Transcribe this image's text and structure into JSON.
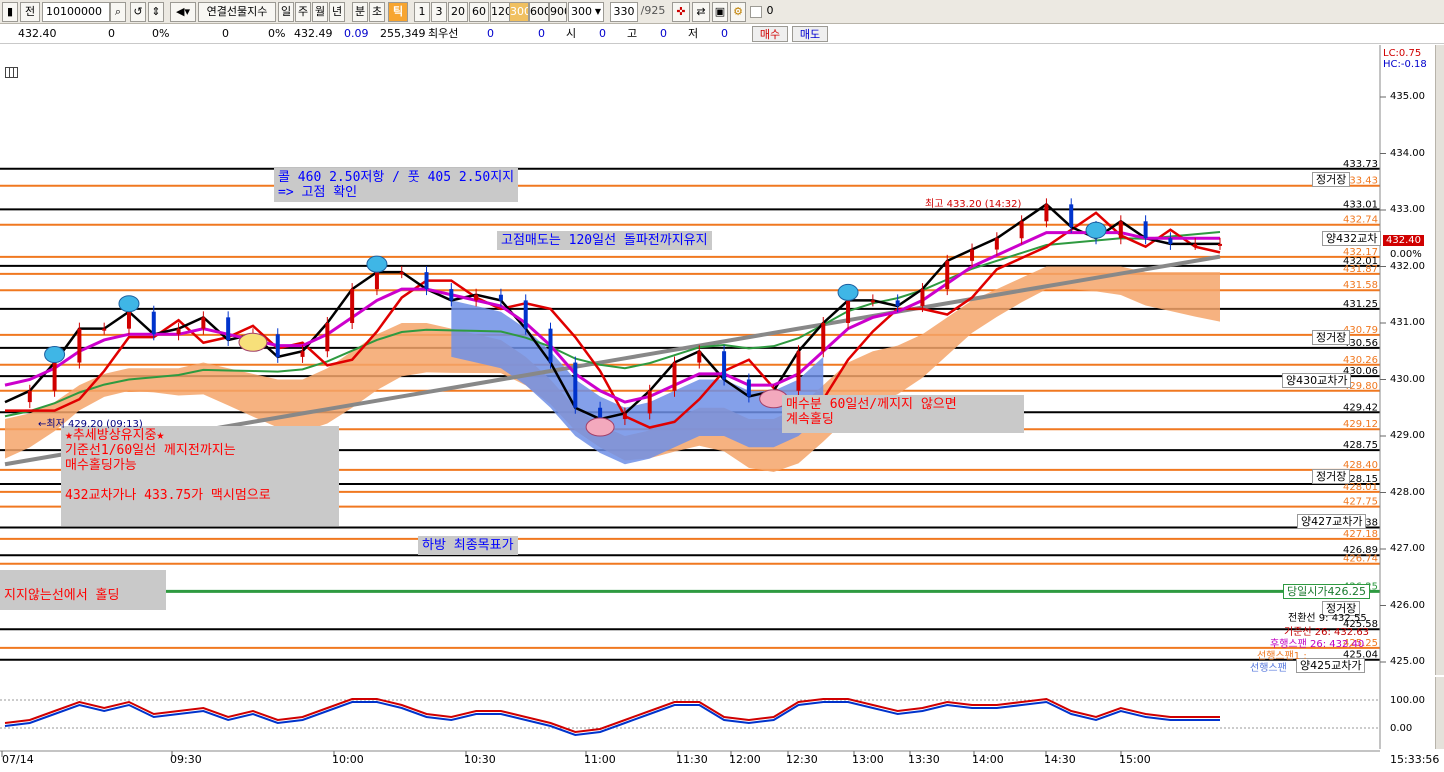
{
  "toolbar": {
    "code": "10100000",
    "labels_left": [
      "전"
    ],
    "product": "연결선물지수",
    "periods": [
      "일",
      "주",
      "월",
      "년",
      "분",
      "초",
      "틱"
    ],
    "intervals": [
      "1",
      "3",
      "20",
      "60",
      "120",
      "300",
      "600",
      "900"
    ],
    "count_value": "300",
    "page_value": "330",
    "page_total": "/925",
    "checkbox_label": "0"
  },
  "quotebar": {
    "price": "432.40",
    "v1": "0",
    "p1": "0%",
    "v2": "0",
    "p2": "0%",
    "last": "432.49",
    "change": "0.09",
    "volume": "255,349",
    "best_label": "최우선",
    "best_v1": "0",
    "best_v2": "0",
    "open_label": "시",
    "open_v": "0",
    "high_label": "고",
    "high_v": "0",
    "low_label": "저",
    "low_v": "0",
    "buy": "매수",
    "sell": "매도"
  },
  "right_info": {
    "lc": "LC:0.75",
    "hc": "HC:-0.18"
  },
  "chart_data": {
    "type": "line",
    "title": "",
    "y_ticks": [
      "435.00",
      "434.00",
      "433.00",
      "432.00",
      "431.00",
      "430.00",
      "429.00",
      "428.00",
      "427.00",
      "426.00",
      "425.00"
    ],
    "x_ticks": [
      "07/14",
      "09:30",
      "10:00",
      "10:30",
      "11:00",
      "11:30",
      "12:00",
      "12:30",
      "13:00",
      "13:30",
      "14:00",
      "14:30",
      "15:00"
    ],
    "current_time": "15:33:56",
    "current_price": "432.40",
    "lower_ticks": [
      "100.00",
      "0.00"
    ],
    "price_levels": [
      {
        "label": "433.73",
        "color": "#000000",
        "value": 433.73
      },
      {
        "label": "433.43",
        "color": "#f07820",
        "value": 433.43
      },
      {
        "label": "433.01",
        "color": "#000000",
        "value": 433.01
      },
      {
        "label": "432.74",
        "color": "#f07820",
        "value": 432.74
      },
      {
        "label": "432.17",
        "color": "#f07820",
        "value": 432.17
      },
      {
        "label": "432.01",
        "color": "#000000",
        "value": 432.01
      },
      {
        "label": "431.87",
        "color": "#f07820",
        "value": 431.87
      },
      {
        "label": "431.58",
        "color": "#f07820",
        "value": 431.58
      },
      {
        "label": "431.25",
        "color": "#000000",
        "value": 431.25
      },
      {
        "label": "430.79",
        "color": "#f07820",
        "value": 430.79
      },
      {
        "label": "430.56",
        "color": "#000000",
        "value": 430.56
      },
      {
        "label": "430.26",
        "color": "#f07820",
        "value": 430.26
      },
      {
        "label": "430.06",
        "color": "#000000",
        "value": 430.06
      },
      {
        "label": "429.80",
        "color": "#f07820",
        "value": 429.8
      },
      {
        "label": "429.42",
        "color": "#000000",
        "value": 429.42
      },
      {
        "label": "429.12",
        "color": "#f07820",
        "value": 429.12
      },
      {
        "label": "428.75",
        "color": "#000000",
        "value": 428.75
      },
      {
        "label": "428.40",
        "color": "#f07820",
        "value": 428.4
      },
      {
        "label": "428.15",
        "color": "#000000",
        "value": 428.15
      },
      {
        "label": "428.01",
        "color": "#f07820",
        "value": 428.01
      },
      {
        "label": "427.75",
        "color": "#f07820",
        "value": 427.75
      },
      {
        "label": "427.38",
        "color": "#000000",
        "value": 427.38
      },
      {
        "label": "427.18",
        "color": "#f07820",
        "value": 427.18
      },
      {
        "label": "426.89",
        "color": "#000000",
        "value": 426.89
      },
      {
        "label": "426.74",
        "color": "#f07820",
        "value": 426.74
      },
      {
        "label": "426.25",
        "color": "#2e9a40",
        "value": 426.25
      },
      {
        "label": "425.58",
        "color": "#000000",
        "value": 425.58
      },
      {
        "label": "425.04",
        "color": "#000000",
        "value": 425.04
      },
      {
        "label": "425.25",
        "color": "#f07820",
        "value": 425.25
      }
    ],
    "series": [
      {
        "name": "price",
        "color": "#000000",
        "values": [
          429.6,
          429.8,
          430.3,
          430.9,
          430.9,
          431.2,
          430.8,
          430.9,
          431.1,
          430.7,
          430.8,
          430.4,
          430.5,
          431.0,
          431.6,
          431.9,
          431.9,
          431.6,
          431.4,
          431.5,
          431.4,
          430.9,
          430.3,
          429.5,
          429.3,
          429.4,
          429.8,
          430.3,
          430.5,
          430.0,
          429.7,
          429.8,
          430.5,
          431.0,
          431.4,
          431.4,
          431.3,
          431.6,
          432.1,
          432.3,
          432.5,
          432.8,
          433.1,
          432.7,
          432.5,
          432.8,
          432.5,
          432.4,
          432.4,
          432.4
        ]
      },
      {
        "name": "ma",
        "color": "#cc00cc",
        "values": [
          429.9,
          430.0,
          430.2,
          430.5,
          430.7,
          430.8,
          430.8,
          430.8,
          430.9,
          430.8,
          430.7,
          430.6,
          430.6,
          430.8,
          431.1,
          431.4,
          431.6,
          431.6,
          431.5,
          431.4,
          431.3,
          431.0,
          430.6,
          430.1,
          429.8,
          429.6,
          429.7,
          429.9,
          430.1,
          430.1,
          429.9,
          429.9,
          430.1,
          430.5,
          430.9,
          431.1,
          431.2,
          431.4,
          431.7,
          432.0,
          432.2,
          432.4,
          432.6,
          432.6,
          432.6,
          432.6,
          432.5,
          432.5,
          432.5,
          432.5
        ]
      }
    ]
  },
  "level_tags": [
    {
      "text": "정거장",
      "value": 433.55
    },
    {
      "text": "양432교차",
      "value": 432.5
    },
    {
      "text": "정거장",
      "value": 430.75
    },
    {
      "text": "양430교차가",
      "value": 430.0
    },
    {
      "text": "정거장",
      "value": 428.3
    },
    {
      "text": "양427교차가",
      "value": 427.5
    },
    {
      "text": "당일시가426.25",
      "value": 426.25
    },
    {
      "text": "정거장",
      "value": 425.95
    },
    {
      "text": "양425교차가",
      "value": 424.95
    }
  ],
  "bottom_right_labels": [
    "전환선 9: 432.55",
    "기준선 26: 432.63",
    "후행스팬 26: 432.40",
    "선행스팬1 :",
    "선행스팬"
  ],
  "annotations": {
    "call_put": "콜 460 2.50저항 / 풋 405 2.50지지\n=> 고점 확인",
    "top_sell": "고점매도는 120일선 돌파전까지유지",
    "trend": "★추세방상유지중★\n기준선1/60일선 께지전까지는\n매수홀딩가능\n\n432교차가나 433.75가 맥시멈으로",
    "target": "하방 최종목표가",
    "hold_line": "지지않는선에서 홀딩",
    "buy_hold": "매수분 60일선/께지지 않으면\n계속홀딩",
    "high_mark": "최고 433.20 (14:32)",
    "low_mark": "←최저 429.20 (09:13)"
  }
}
